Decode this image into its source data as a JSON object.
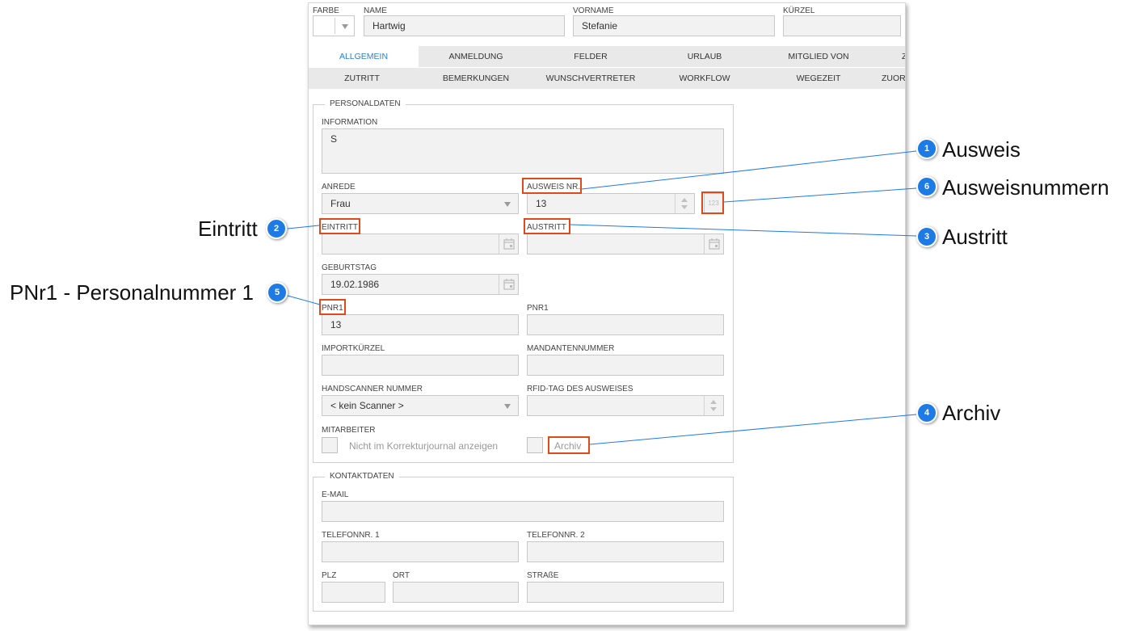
{
  "header": {
    "farbe_label": "FARBE",
    "name_label": "NAME",
    "name_value": "Hartwig",
    "vorname_label": "VORNAME",
    "vorname_value": "Stefanie",
    "kuerzel_label": "KÜRZEL",
    "kuerzel_value": ""
  },
  "tabs_row1": [
    "ALLGEMEIN",
    "ANMELDUNG",
    "FELDER",
    "URLAUB",
    "MITGLIED VON",
    "Z"
  ],
  "tabs_row2": [
    "ZUTRITT",
    "BEMERKUNGEN",
    "WUNSCHVERTRETER",
    "WORKFLOW",
    "WEGEZEIT",
    "ZUOR"
  ],
  "personaldaten": {
    "legend": "PERSONALDATEN",
    "information_label": "INFORMATION",
    "information_value": "S",
    "anrede_label": "ANREDE",
    "anrede_value": "Frau",
    "ausweis_label": "AUSWEIS NR.",
    "ausweis_value": "13",
    "ausweis_button": "123",
    "eintritt_label": "EINTRITT",
    "eintritt_value": "",
    "austritt_label": "AUSTRITT",
    "austritt_value": "",
    "geburtstag_label": "GEBURTSTAG",
    "geburtstag_value": "19.02.1986",
    "pnr1_label": "PNR1",
    "pnr1_value": "13",
    "pnr1b_label": "PNR1",
    "pnr1b_value": "",
    "importkuerzel_label": "IMPORTKÜRZEL",
    "mandantennummer_label": "MANDANTENNUMMER",
    "handscanner_label": "HANDSCANNER NUMMER",
    "handscanner_value": "< kein Scanner >",
    "rfid_label": "RFID-TAG DES AUSWEISES",
    "mitarbeiter_label": "MITARBEITER",
    "korrektur_label": "Nicht im Korrekturjournal anzeigen",
    "archiv_label": "Archiv"
  },
  "kontaktdaten": {
    "legend": "KONTAKTDATEN",
    "email_label": "E-MAIL",
    "tel1_label": "TELEFONNR. 1",
    "tel2_label": "TELEFONNR. 2",
    "plz_label": "PLZ",
    "ort_label": "ORT",
    "strasse_label": "STRAßE"
  },
  "callouts": {
    "c1_num": "1",
    "c1_text": "Ausweis",
    "c2_num": "2",
    "c2_text": "Eintritt",
    "c3_num": "3",
    "c3_text": "Austritt",
    "c4_num": "4",
    "c4_text": "Archiv",
    "c5_num": "5",
    "c5_text": "PNr1 - Personalnummer 1",
    "c6_num": "6",
    "c6_text": "Ausweisnummern"
  },
  "colors": {
    "accent": "#1e7be6",
    "highlight": "#e04a1a",
    "active_tab_text": "#2a7fd4"
  }
}
